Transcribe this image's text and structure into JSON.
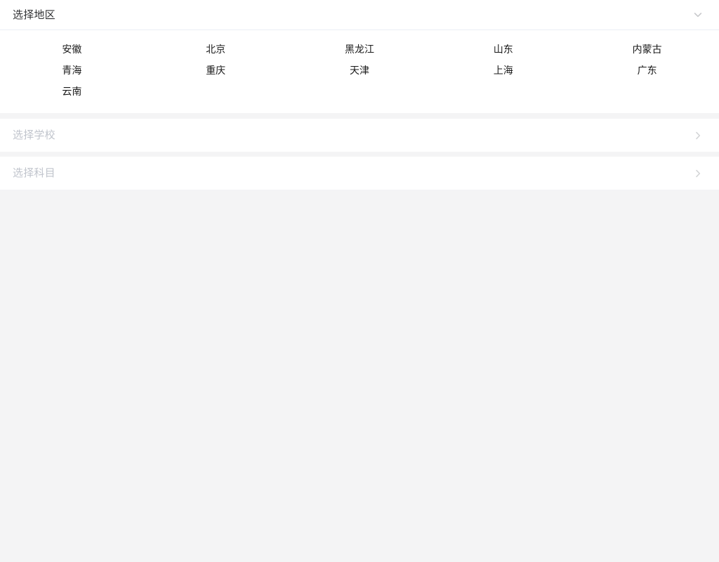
{
  "app": {
    "background_color": "#f4f4f5",
    "surface_color": "#ffffff"
  },
  "region_section": {
    "title": "选择地区",
    "expanded": true,
    "toggle_icon": "chevron-down-icon",
    "columns": 5,
    "items": [
      "安徽",
      "北京",
      "黑龙江",
      "山东",
      "内蒙古",
      "青海",
      "重庆",
      "天津",
      "上海",
      "广东",
      "云南"
    ]
  },
  "school_row": {
    "label": "选择学校",
    "state": "placeholder",
    "icon": "chevron-right-icon",
    "text_color": "#c0c4cc"
  },
  "subject_row": {
    "label": "选择科目",
    "state": "placeholder",
    "icon": "chevron-right-icon",
    "text_color": "#c0c4cc"
  }
}
